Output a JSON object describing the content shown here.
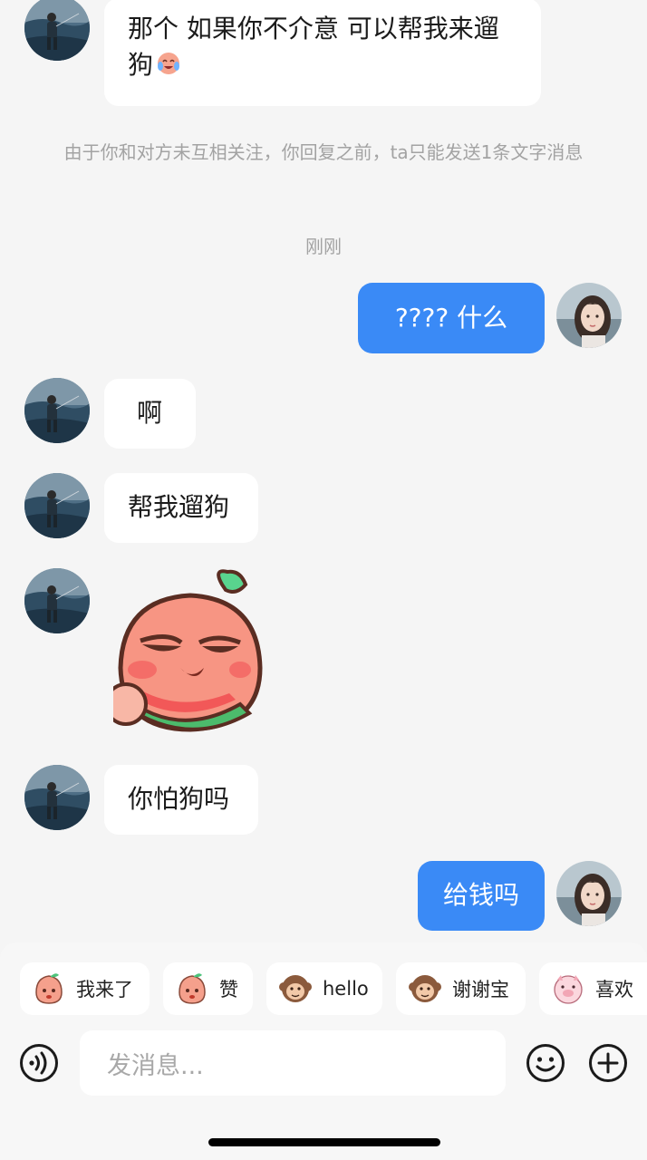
{
  "chat": {
    "messages": [
      {
        "text": "那个 如果你不介意 可以帮我来遛狗"
      },
      {
        "text": "由于你和对方未互相关注，你回复之前，ta只能发送1条文字消息"
      },
      {
        "text": "刚刚"
      },
      {
        "text": "???? 什么"
      },
      {
        "text": "啊"
      },
      {
        "text": "帮我遛狗"
      },
      {
        "text": "你怕狗吗"
      },
      {
        "text": "给钱吗"
      }
    ]
  },
  "quick_replies": [
    {
      "label": "我来了",
      "icon": "peach-sticker-icon"
    },
    {
      "label": "赞",
      "icon": "peach-sticker-icon"
    },
    {
      "label": "hello",
      "icon": "monkey-sticker-icon"
    },
    {
      "label": "谢谢宝",
      "icon": "monkey-sticker-icon"
    },
    {
      "label": "喜欢",
      "icon": "pig-sticker-icon"
    }
  ],
  "composer": {
    "placeholder": "发消息...",
    "voice_icon": "voice-icon",
    "emoji_icon": "emoji-icon",
    "add_icon": "plus-icon"
  },
  "colors": {
    "outgoing_bubble": "#3a8af6",
    "incoming_bubble": "#ffffff",
    "background": "#f5f5f5"
  }
}
